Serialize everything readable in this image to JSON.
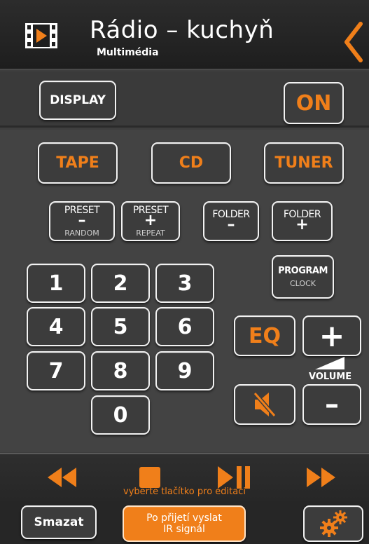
{
  "header": {
    "title": "Rádio – kuchyň",
    "subtitle": "Multimédia",
    "app_icon": "film-play-icon",
    "back_icon": "chevron-left-icon"
  },
  "top_row": {
    "display_label": "DISPLAY",
    "on_label": "ON"
  },
  "sources": {
    "tape_label": "TAPE",
    "cd_label": "CD",
    "tuner_label": "TUNER"
  },
  "preset_minus": {
    "top": "PRESET",
    "symbol": "–",
    "sub": "RANDOM"
  },
  "preset_plus": {
    "top": "PRESET",
    "symbol": "+",
    "sub": "REPEAT"
  },
  "folder_minus": {
    "top": "FOLDER",
    "symbol": "–"
  },
  "folder_plus": {
    "top": "FOLDER",
    "symbol": "+"
  },
  "program": {
    "top": "PROGRAM",
    "sub": "CLOCK"
  },
  "keypad": [
    "1",
    "2",
    "3",
    "4",
    "5",
    "6",
    "7",
    "8",
    "9",
    "0"
  ],
  "eq_label": "EQ",
  "volume": {
    "plus_label": "+",
    "minus_label": "–",
    "label": "VOLUME",
    "mute_icon": "speaker-mute-icon"
  },
  "transport": {
    "rewind_icon": "rewind-icon",
    "stop_icon": "stop-icon",
    "play_pause_icon": "play-pause-icon",
    "forward_icon": "fast-forward-icon",
    "status_text": "vyberte tlačítko pro editaci"
  },
  "bottom_bar": {
    "clear_label": "Smazat",
    "send_line1": "Po přijetí vyslat",
    "send_line2": "IR signál",
    "settings_icon": "gears-icon"
  },
  "colors": {
    "accent": "#f07f1a",
    "background": "#3e3e3e",
    "button_border": "#f2f2f2"
  }
}
